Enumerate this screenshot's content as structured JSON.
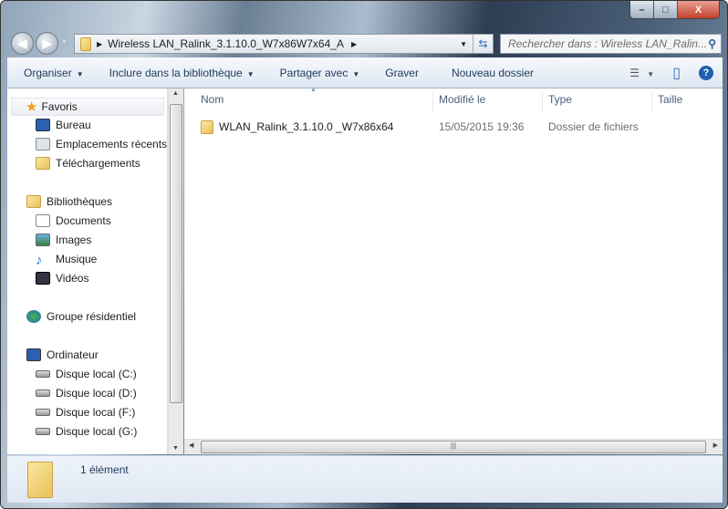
{
  "window": {
    "controls": {
      "minimize": "–",
      "maximize": "□",
      "close": "X"
    }
  },
  "address": {
    "path": "Wireless LAN_Ralink_3.1.10.0_W7x86W7x64_A",
    "search_placeholder": "Rechercher dans : Wireless LAN_Ralin..."
  },
  "toolbar": {
    "organize": "Organiser",
    "include": "Inclure dans la bibliothèque",
    "share": "Partager avec",
    "burn": "Graver",
    "new_folder": "Nouveau dossier"
  },
  "nav": {
    "favorites": "Favoris",
    "desktop": "Bureau",
    "recent": "Emplacements récents",
    "downloads": "Téléchargements",
    "libraries": "Bibliothèques",
    "documents": "Documents",
    "images": "Images",
    "music": "Musique",
    "videos": "Vidéos",
    "homegroup": "Groupe résidentiel",
    "computer": "Ordinateur",
    "disks": [
      "Disque local (C:)",
      "Disque local (D:)",
      "Disque local (F:)",
      "Disque local (G:)"
    ]
  },
  "columns": {
    "name": "Nom",
    "modified": "Modifié le",
    "type": "Type",
    "size": "Taille"
  },
  "files": [
    {
      "name": "WLAN_Ralink_3.1.10.0 _W7x86x64",
      "modified": "15/05/2015 19:36",
      "type": "Dossier de fichiers",
      "size": ""
    }
  ],
  "status": {
    "count": "1 élément"
  }
}
